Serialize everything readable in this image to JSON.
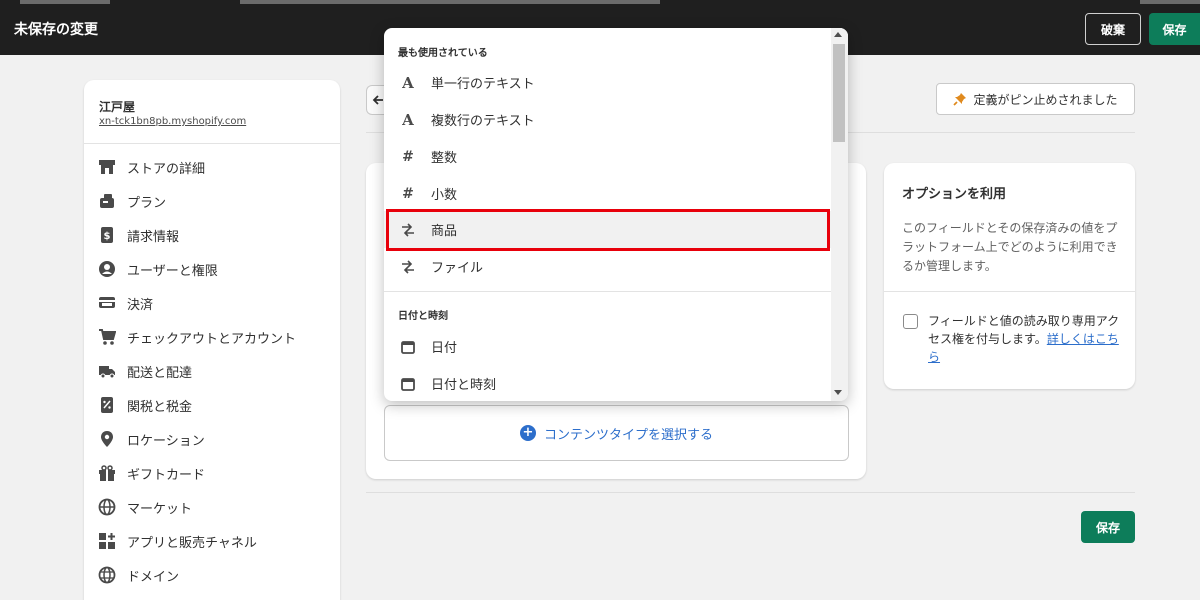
{
  "topbar": {
    "title": "未保存の変更",
    "discard_label": "破棄",
    "save_label": "保存"
  },
  "store": {
    "name": "江戸屋",
    "url": "xn-tck1bn8pb.myshopify.com"
  },
  "sidebar": {
    "items": [
      {
        "label": "ストアの詳細",
        "icon": "store-icon"
      },
      {
        "label": "プラン",
        "icon": "plan-icon"
      },
      {
        "label": "請求情報",
        "icon": "billing-icon"
      },
      {
        "label": "ユーザーと権限",
        "icon": "user-icon"
      },
      {
        "label": "決済",
        "icon": "payment-card-icon"
      },
      {
        "label": "チェックアウトとアカウント",
        "icon": "cart-icon"
      },
      {
        "label": "配送と配達",
        "icon": "truck-icon"
      },
      {
        "label": "関税と税金",
        "icon": "tax-icon"
      },
      {
        "label": "ロケーション",
        "icon": "location-pin-icon"
      },
      {
        "label": "ギフトカード",
        "icon": "gift-icon"
      },
      {
        "label": "マーケット",
        "icon": "globe-icon"
      },
      {
        "label": "アプリと販売チャネル",
        "icon": "apps-icon"
      },
      {
        "label": "ドメイン",
        "icon": "domain-globe-icon"
      }
    ]
  },
  "main": {
    "pinned_label": "定義がピン止めされました",
    "content_type_button": "コンテンツタイプを選択する",
    "save_label": "保存"
  },
  "options": {
    "title": "オプションを利用",
    "description": "このフィールドとその保存済みの値をプラットフォーム上でどのように利用できるか管理します。",
    "checkbox_label": "フィールドと値の読み取り専用アクセス権を付与します。",
    "learn_more": "詳しくはこちら"
  },
  "dropdown": {
    "section_most_used": "最も使用されている",
    "section_datetime": "日付と時刻",
    "items": [
      {
        "label": "単一行のテキスト",
        "icon": "text-letter-icon"
      },
      {
        "label": "複数行のテキスト",
        "icon": "text-letter-icon"
      },
      {
        "label": "整数",
        "icon": "hash-icon"
      },
      {
        "label": "小数",
        "icon": "hash-icon"
      },
      {
        "label": "商品",
        "icon": "reference-arrows-icon",
        "highlighted": true
      },
      {
        "label": "ファイル",
        "icon": "reference-arrows-icon"
      }
    ],
    "datetime_items": [
      {
        "label": "日付",
        "icon": "calendar-icon"
      },
      {
        "label": "日付と時刻",
        "icon": "calendar-icon"
      }
    ],
    "highlight_color": "#e8000b"
  },
  "colors": {
    "topbar_bg": "#1f1f1f",
    "primary_green": "#0d7d5a",
    "link_blue": "#2c6ecb"
  }
}
